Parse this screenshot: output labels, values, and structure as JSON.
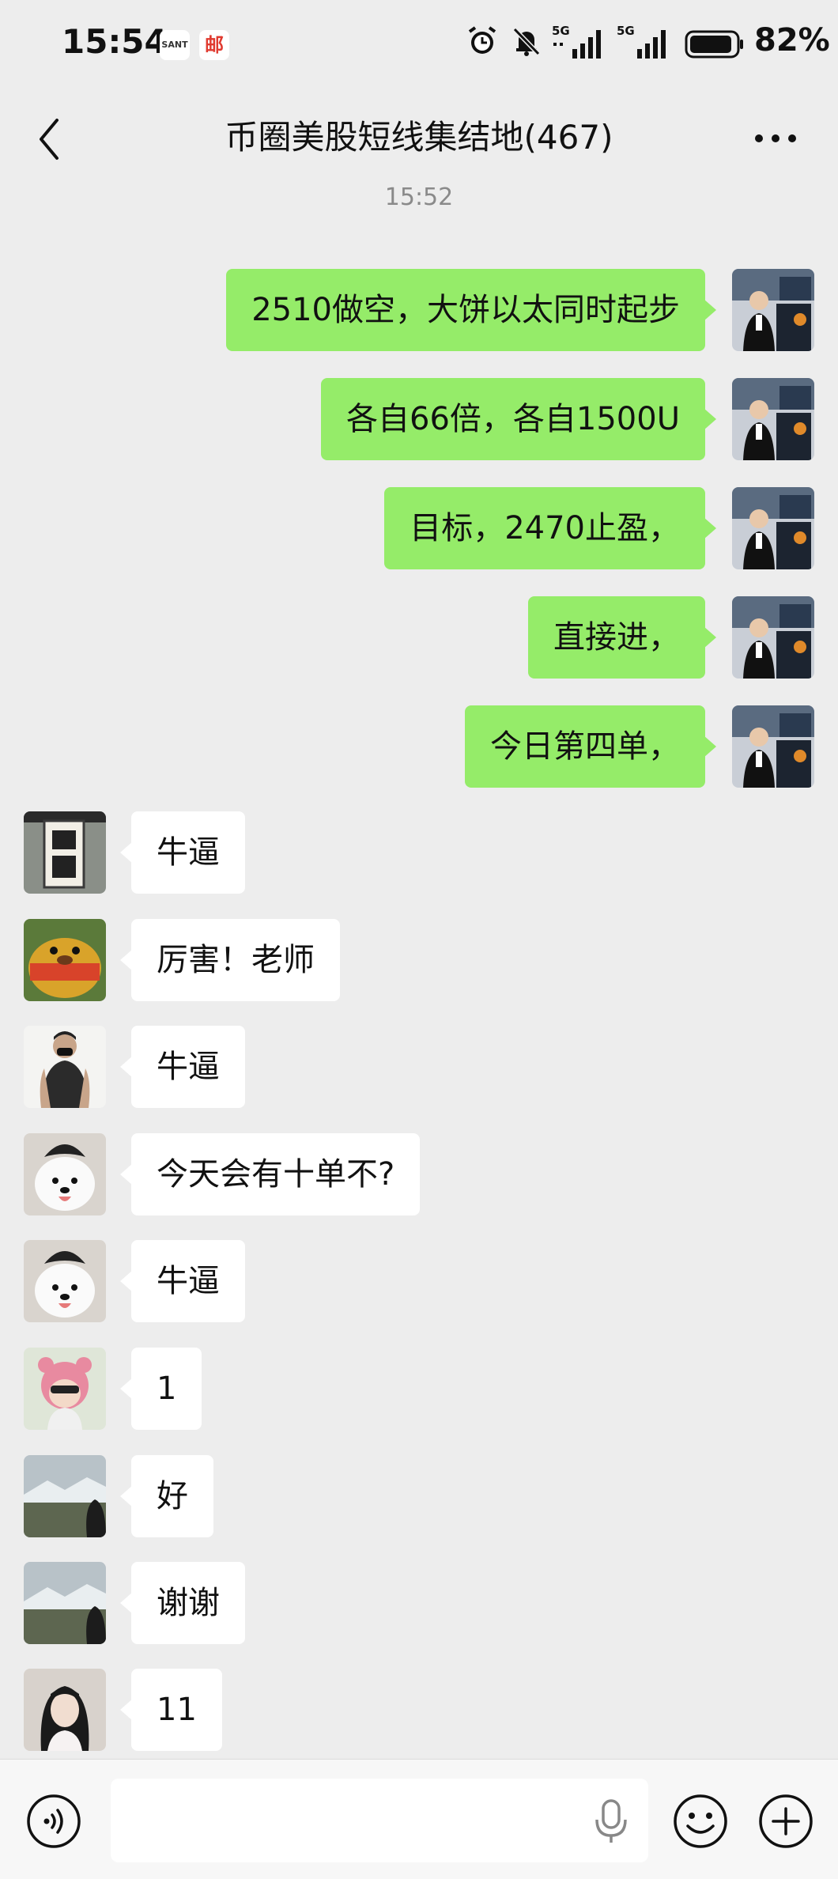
{
  "status_bar": {
    "time": "15:54",
    "app_badges": [
      "SANT",
      "邮"
    ],
    "network_1": "5G",
    "network_2": "5G",
    "battery": "82%"
  },
  "nav": {
    "title": "币圈美股短线集结地(467)"
  },
  "timestamp": "15:52",
  "messages": [
    {
      "direction": "out",
      "text": "2510做空，大饼以太同时起步",
      "avatar": "trader-avatar"
    },
    {
      "direction": "out",
      "text": "各自66倍，各自1500U",
      "avatar": "trader-avatar"
    },
    {
      "direction": "out",
      "text": "目标，2470止盈，",
      "avatar": "trader-avatar"
    },
    {
      "direction": "out",
      "text": "直接进，",
      "avatar": "trader-avatar"
    },
    {
      "direction": "out",
      "text": "今日第四单，",
      "avatar": "trader-avatar"
    },
    {
      "direction": "in",
      "text": "牛逼",
      "avatar": "caishen-sign-avatar"
    },
    {
      "direction": "in",
      "text": "厉害！老师",
      "avatar": "cartoon-bear-avatar"
    },
    {
      "direction": "in",
      "text": "牛逼",
      "avatar": "masked-man-avatar"
    },
    {
      "direction": "in",
      "text": "今天会有十单不?",
      "avatar": "samoyed-avatar"
    },
    {
      "direction": "in",
      "text": "牛逼",
      "avatar": "samoyed-avatar"
    },
    {
      "direction": "in",
      "text": "1",
      "avatar": "pink-hat-avatar"
    },
    {
      "direction": "in",
      "text": "好",
      "avatar": "landscape-avatar"
    },
    {
      "direction": "in",
      "text": "谢谢",
      "avatar": "landscape-avatar"
    },
    {
      "direction": "in",
      "text": "11",
      "avatar": "girl-avatar"
    }
  ],
  "input_bar": {
    "placeholder": "",
    "icons": [
      "voice-icon",
      "microphone-icon",
      "emoji-icon",
      "plus-icon"
    ]
  },
  "colors": {
    "background": "#ededed",
    "outgoing_bubble": "#95ec69",
    "incoming_bubble": "#ffffff"
  }
}
